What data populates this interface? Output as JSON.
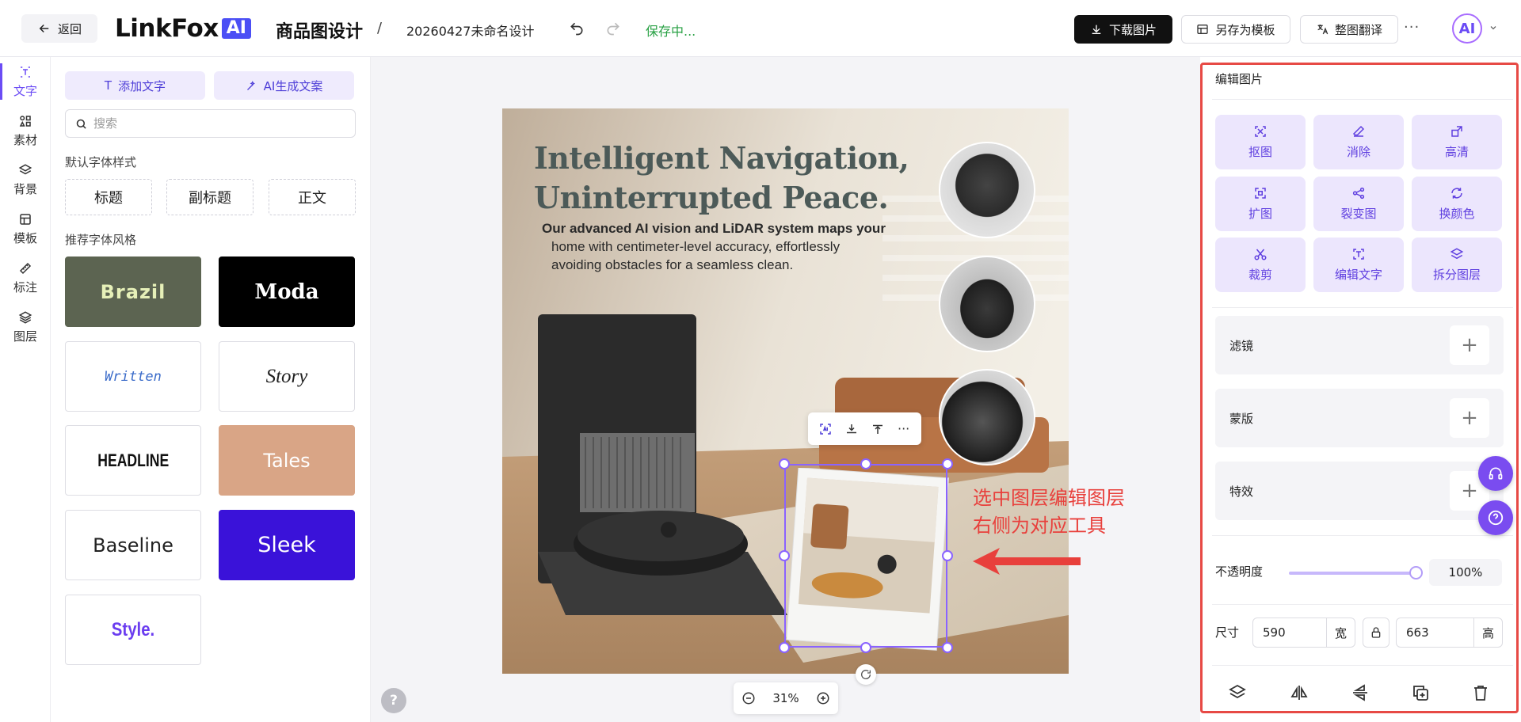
{
  "header": {
    "back_label": "返回",
    "logo_text": "LinkFox",
    "logo_badge": "AI",
    "app_title": "商品图设计",
    "separator": "/",
    "design_name": "20260427未命名设计",
    "save_status": "保存中...",
    "download_label": "下载图片",
    "save_template_label": "另存为模板",
    "translate_label": "整图翻译",
    "more_label": "···",
    "avatar_text": "AI"
  },
  "rail": [
    {
      "label": "文字",
      "icon": "text-icon",
      "active": true
    },
    {
      "label": "素材",
      "icon": "shapes-icon"
    },
    {
      "label": "背景",
      "icon": "layers-icon"
    },
    {
      "label": "模板",
      "icon": "template-icon"
    },
    {
      "label": "标注",
      "icon": "ruler-icon"
    },
    {
      "label": "图层",
      "icon": "stack-icon"
    }
  ],
  "text_panel": {
    "add_text_label": "添加文字",
    "ai_copy_label": "AI生成文案",
    "search_placeholder": "搜索",
    "default_styles_label": "默认字体样式",
    "default_styles": [
      "标题",
      "副标题",
      "正文"
    ],
    "recommended_label": "推荐字体风格",
    "font_styles": [
      "Brazil",
      "Moda",
      "Written",
      "Story",
      "HEADLINE",
      "Tales",
      "Baseline",
      "Sleek",
      "Style."
    ]
  },
  "artboard": {
    "headline_1": "Intelligent Navigation,",
    "headline_2": "Uninterrupted Peace.",
    "copy_1": "Our advanced AI vision and LiDAR system maps your",
    "copy_2": "home with centimeter-level accuracy, effortlessly",
    "copy_3": "avoiding obstacles for a seamless clean."
  },
  "annotation": {
    "line_1": "选中图层编辑图层",
    "line_2": "右侧为对应工具",
    "color": "#e8403c"
  },
  "zoom": {
    "value": "31%"
  },
  "help_label": "?",
  "edit_panel": {
    "title": "编辑图片",
    "tools": [
      "抠图",
      "消除",
      "高清",
      "扩图",
      "裂变图",
      "换颜色",
      "裁剪",
      "编辑文字",
      "拆分图层"
    ],
    "filter_label": "滤镜",
    "mask_label": "蒙版",
    "effects_label": "特效",
    "plus": "+",
    "opacity_label": "不透明度",
    "opacity_value": "100%",
    "opacity_fraction": 1.0,
    "size_label": "尺寸",
    "width_value": "590",
    "width_unit": "宽",
    "height_value": "663",
    "height_unit": "高"
  },
  "colors": {
    "accent": "#6b4cf5",
    "tool_bg": "#ece6fd",
    "primary_dark": "#111111",
    "saving_green": "#27a043",
    "highlight_red": "#e74a45"
  }
}
